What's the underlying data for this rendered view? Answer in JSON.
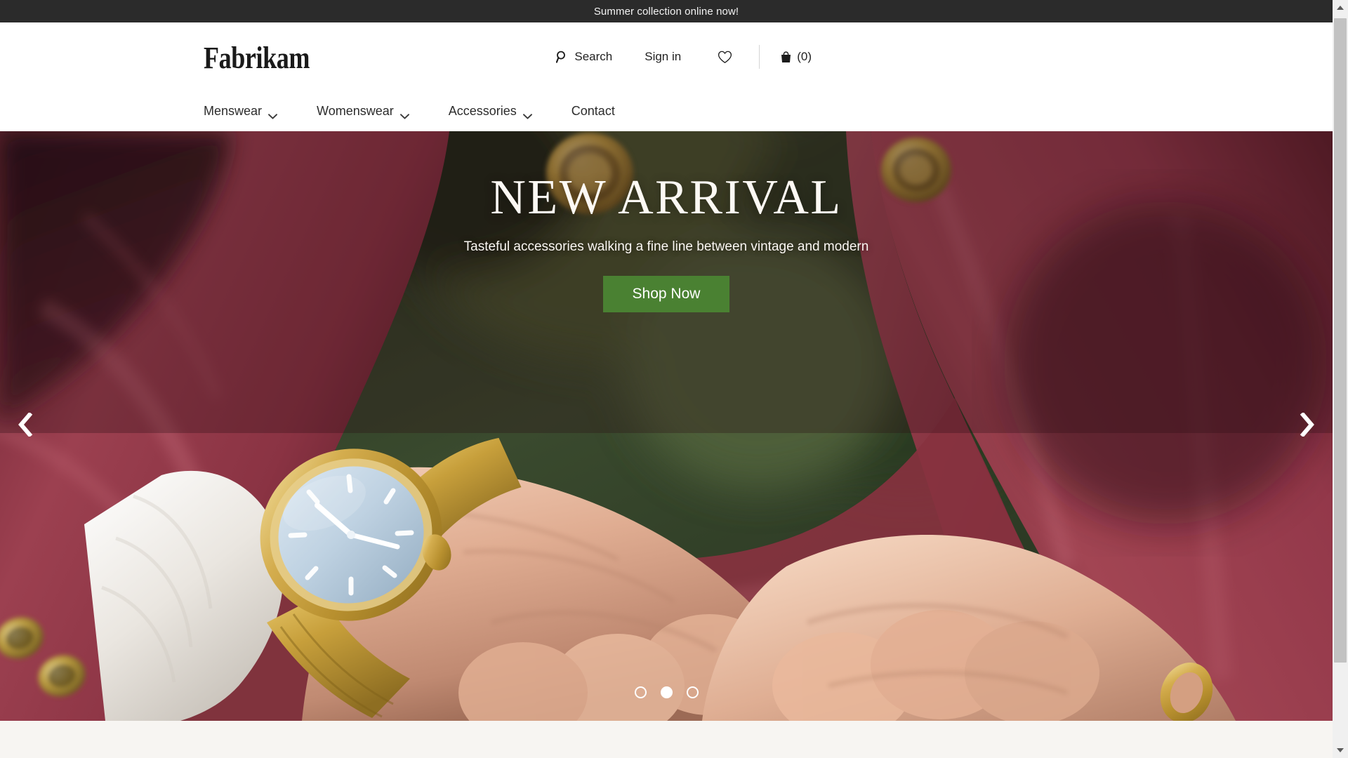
{
  "announcement": {
    "text": "Summer collection online now!"
  },
  "header": {
    "logo": "Fabrikam",
    "actions": {
      "search_label": "Search",
      "signin_label": "Sign in",
      "wishlist_icon": "heart-icon",
      "bag_icon": "shopping-bag-icon",
      "bag_count": "(0)"
    },
    "nav": [
      {
        "label": "Menswear",
        "has_dropdown": true
      },
      {
        "label": "Womenswear",
        "has_dropdown": true
      },
      {
        "label": "Accessories",
        "has_dropdown": true
      },
      {
        "label": "Contact",
        "has_dropdown": false
      }
    ]
  },
  "hero": {
    "title": "NEW ARRIVAL",
    "subtitle": "Tasteful accessories walking a fine line between vintage and modern",
    "cta_label": "Shop Now",
    "prev_icon": "chevron-left-icon",
    "next_icon": "chevron-right-icon",
    "slides": [
      {
        "index": "1",
        "active": false
      },
      {
        "index": "2",
        "active": true
      },
      {
        "index": "3",
        "active": false
      }
    ],
    "image_description": "Close-up of a man in a maroon wool blazer with ornate gold buttons, wearing a gold mesh-band wristwatch with a pale blue dial"
  },
  "colors": {
    "announcement_bg": "#2b2b2b",
    "cta_green": "#4a8132",
    "jacket_maroon": "#8c3444",
    "background_green": "#2e3b26",
    "page_bg": "#f7f5f2"
  },
  "scrollbar": {
    "up_icon": "scroll-up-arrow-icon",
    "down_icon": "scroll-down-arrow-icon"
  }
}
